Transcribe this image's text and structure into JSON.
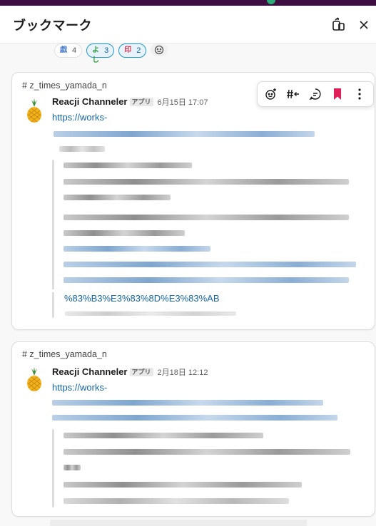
{
  "header": {
    "title": "ブックマーク"
  },
  "reactions": [
    {
      "emoji": "skull-text",
      "glyph": "戯",
      "count": "4",
      "active": false
    },
    {
      "emoji": "yoshi-text",
      "glyph": "よし",
      "count": "3",
      "active": true
    },
    {
      "emoji": "stamp-text",
      "glyph": "印",
      "count": "2",
      "active": true
    }
  ],
  "bookmarks": [
    {
      "channel": "# z_times_yamada_n",
      "sender": "Reacji Channeler",
      "app_badge": "アプリ",
      "time": "6月15日 17:07",
      "link_prefix": "https://works-",
      "url_tail": "%83%B3%E3%83%8D%E3%83%AB"
    },
    {
      "channel": "# z_times_yamada_n",
      "sender": "Reacji Channeler",
      "app_badge": "アプリ",
      "time": "2月18日 12:12",
      "link_prefix": "https://works-"
    }
  ],
  "colors": {
    "accent": "#1264a3",
    "bookmark": "#e01e5a",
    "topbar": "#3f0e40"
  }
}
